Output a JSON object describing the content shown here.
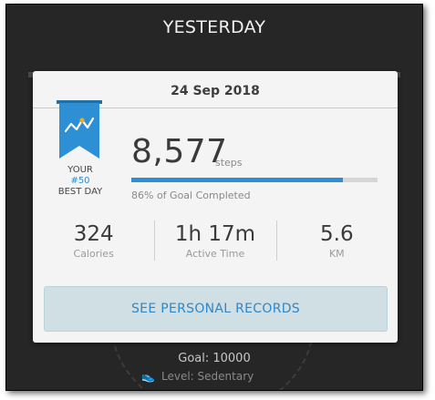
{
  "header": {
    "title": "YESTERDAY"
  },
  "background": {
    "goal_text": "Goal: 10000",
    "level_text": "Level: Sedentary",
    "level_icon": "shoe-icon"
  },
  "card": {
    "date": "24 Sep 2018",
    "badge": {
      "line1": "YOUR",
      "rank": "#50",
      "line3": "BEST DAY",
      "icon": "ribbon-chart-icon",
      "color": "#2d8fd4"
    },
    "steps": {
      "value": "8,577",
      "unit": "steps",
      "goal_fraction": 0.86,
      "goal_text": "86% of Goal Completed"
    },
    "stats": [
      {
        "value": "324",
        "label": "Calories"
      },
      {
        "value": "1h 17m",
        "label": "Active Time"
      },
      {
        "value": "5.6",
        "label": "KM"
      }
    ],
    "records_button_label": "SEE PERSONAL RECORDS"
  },
  "colors": {
    "accent": "#2d8fd4",
    "card_background": "#f4f4f4",
    "app_background": "#262626"
  }
}
